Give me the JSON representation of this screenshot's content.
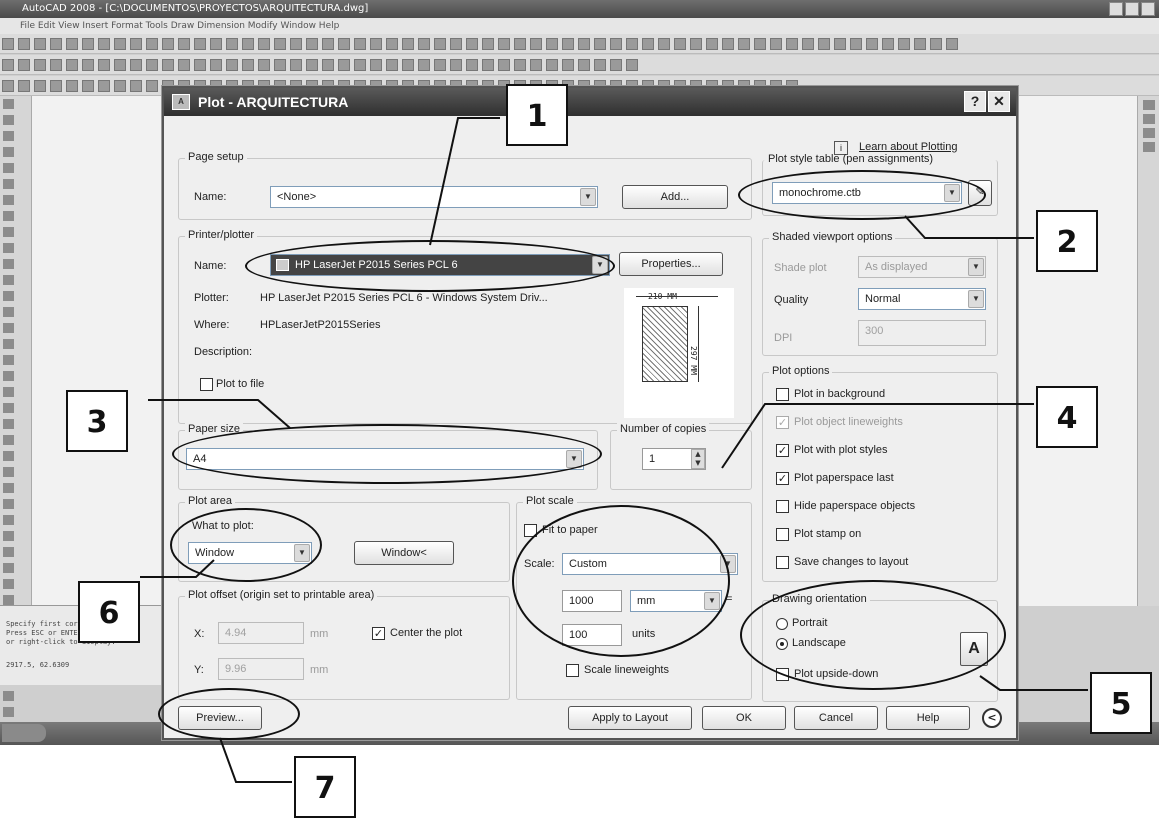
{
  "background": {
    "window_title": "AutoCAD 2008 - [C:\\DOCUMENTOS\\PROYECTOS\\ARQUITECTURA.dwg]",
    "menu": "File  Edit  View  Insert  Format  Tools  Draw  Dimension  Modify  Window  Help",
    "command_lines": [
      "Specify first corner:",
      "Press ESC or ENTER to exit,",
      "or right-click to display."
    ],
    "status": "2917.5, 62.6309"
  },
  "dialog": {
    "title": "Plot - ARQUITECTURA",
    "learn_link": "Learn about Plotting",
    "page_setup": {
      "group": "Page setup",
      "name_label": "Name:",
      "name_value": "<None>",
      "add_button": "Add..."
    },
    "printer": {
      "group": "Printer/plotter",
      "name_label": "Name:",
      "name_value": "HP LaserJet P2015 Series PCL 6",
      "properties_button": "Properties...",
      "plotter_label": "Plotter:",
      "plotter_value": "HP LaserJet P2015 Series PCL 6 - Windows System Driv...",
      "where_label": "Where:",
      "where_value": "HPLaserJetP2015Series",
      "description_label": "Description:",
      "plot_to_file": "Plot to file",
      "paper_width": "210 MM",
      "paper_height": "297 MM"
    },
    "paper_size": {
      "group": "Paper size",
      "value": "A4"
    },
    "copies": {
      "group": "Number of copies",
      "value": "1"
    },
    "plot_area": {
      "group": "Plot area",
      "what_label": "What to plot:",
      "what_value": "Window",
      "window_button": "Window<"
    },
    "plot_offset": {
      "group": "Plot offset (origin set to printable area)",
      "x_label": "X:",
      "x_value": "4.94",
      "x_unit": "mm",
      "y_label": "Y:",
      "y_value": "9.96",
      "y_unit": "mm",
      "center_label": "Center the plot"
    },
    "plot_scale": {
      "group": "Plot scale",
      "fit_label": "Fit to paper",
      "scale_label": "Scale:",
      "scale_value": "Custom",
      "value1": "1000",
      "unit1": "mm",
      "value2": "100",
      "unit2": "units",
      "equals": "=",
      "lineweights_label": "Scale lineweights"
    },
    "plot_style": {
      "group": "Plot style table (pen assignments)",
      "value": "monochrome.ctb"
    },
    "shaded": {
      "group": "Shaded viewport options",
      "shade_label": "Shade plot",
      "shade_value": "As displayed",
      "quality_label": "Quality",
      "quality_value": "Normal",
      "dpi_label": "DPI",
      "dpi_value": "300"
    },
    "plot_options": {
      "group": "Plot options",
      "items": [
        {
          "label": "Plot in background",
          "checked": false,
          "disabled": false
        },
        {
          "label": "Plot object lineweights",
          "checked": true,
          "disabled": true
        },
        {
          "label": "Plot with plot styles",
          "checked": true,
          "disabled": false
        },
        {
          "label": "Plot paperspace last",
          "checked": true,
          "disabled": false
        },
        {
          "label": "Hide paperspace objects",
          "checked": false,
          "disabled": false
        },
        {
          "label": "Plot stamp on",
          "checked": false,
          "disabled": false
        },
        {
          "label": "Save changes to layout",
          "checked": false,
          "disabled": false
        }
      ]
    },
    "orientation": {
      "group": "Drawing orientation",
      "portrait": "Portrait",
      "landscape": "Landscape",
      "upside_down": "Plot upside-down",
      "icon_letter": "A"
    },
    "buttons": {
      "preview": "Preview...",
      "apply": "Apply to Layout",
      "ok": "OK",
      "cancel": "Cancel",
      "help": "Help"
    }
  },
  "callouts": [
    "1",
    "2",
    "3",
    "4",
    "5",
    "6",
    "7"
  ]
}
